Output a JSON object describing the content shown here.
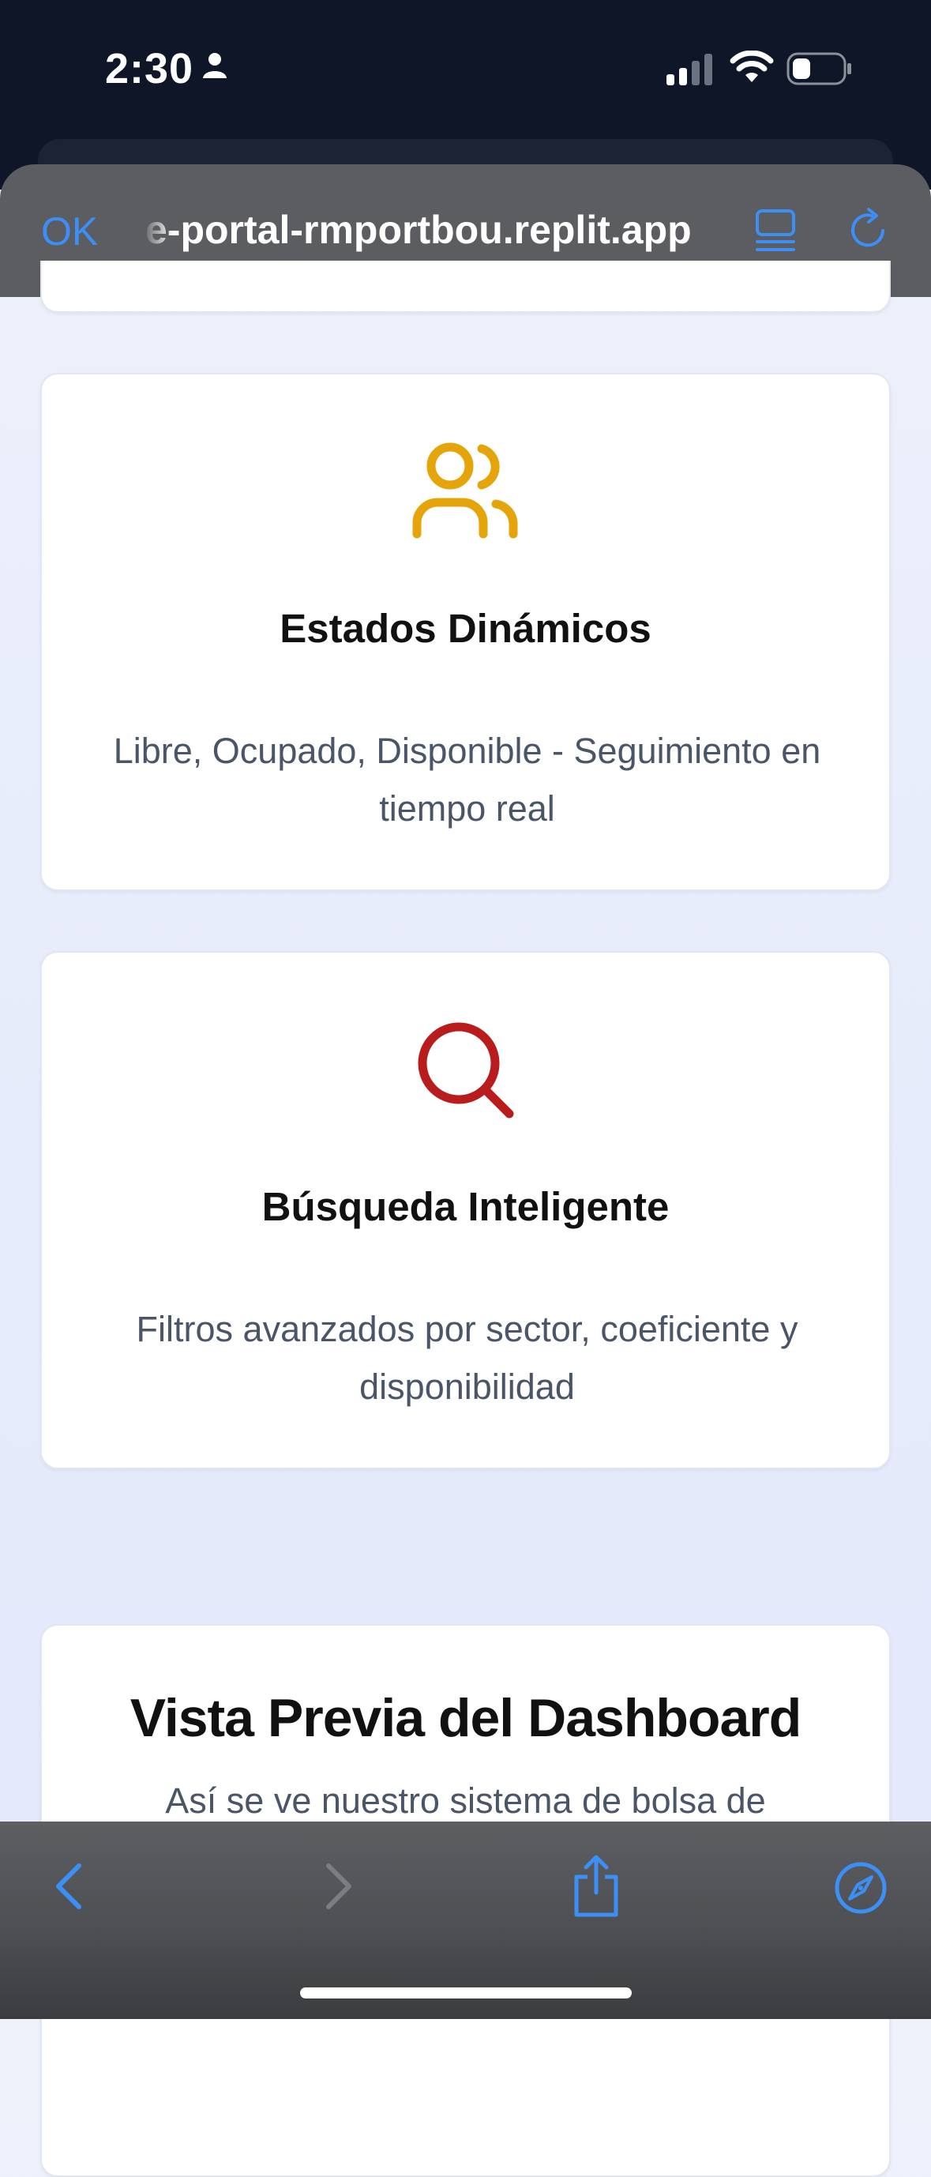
{
  "status_bar": {
    "time": "2:30"
  },
  "browser": {
    "done_label": "OK",
    "url": "e-portal-rmportbou.replit.app"
  },
  "features": [
    {
      "title": "Estados Dinámicos",
      "description": "Libre, Ocupado, Disponible - Seguimiento en tiempo real",
      "icon": "users-icon",
      "icon_color": "#e5a50a"
    },
    {
      "title": "Búsqueda Inteligente",
      "description": "Filtros avanzados por sector, coeficiente y disponibilidad",
      "icon": "search-icon",
      "icon_color": "#b91c1c"
    }
  ],
  "dashboard_preview": {
    "title": "Vista Previa del Dashboard",
    "subtitle": "Así se ve nuestro sistema de bolsa de"
  },
  "colors": {
    "accent": "#3b8ff6",
    "status_bar_bg": "#0e1628",
    "toolbar_bg": "#5b5d60"
  }
}
